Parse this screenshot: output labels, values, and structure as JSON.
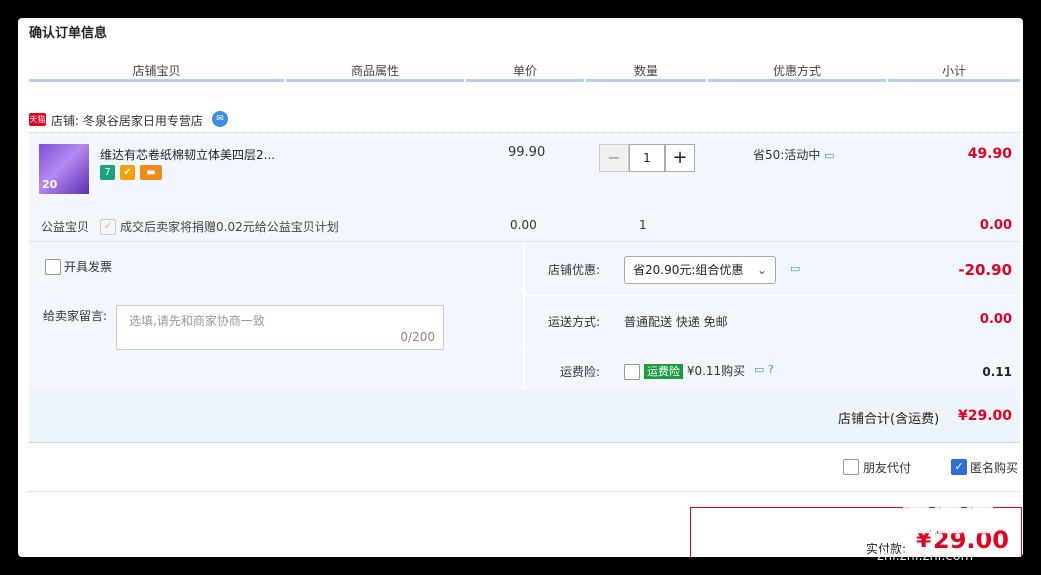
{
  "page": {
    "title": "确认订单信息"
  },
  "columns": [
    "店铺宝贝",
    "商品属性",
    "单价",
    "数量",
    "优惠方式",
    "小计"
  ],
  "shop": {
    "tmall_badge": "天猫",
    "label": "店铺: 冬泉谷居家日用专营店"
  },
  "item": {
    "thumb_text": "20",
    "title": "维达有芯卷纸棉韧立体美四层2...",
    "badges": [
      "7",
      "✔",
      "▬"
    ],
    "price": "99.90",
    "quantity": "1",
    "minus": "−",
    "plus": "+",
    "promo": "省50:活动中",
    "subtotal": "49.90"
  },
  "charity": {
    "label": "公益宝贝",
    "text": "成交后卖家将捐赠0.02元给公益宝贝计划",
    "price": "0.00",
    "quantity": "1",
    "subtotal": "0.00"
  },
  "invoice": {
    "label": "开具发票"
  },
  "message": {
    "label": "给卖家留言:",
    "placeholder": "选填,请先和商家协商一致",
    "counter": "0/200"
  },
  "discount": {
    "label": "店铺优惠:",
    "selected": "省20.90元:组合优惠",
    "amount": "-20.90"
  },
  "shipping": {
    "label": "运送方式:",
    "value": "普通配送 快递 免邮",
    "amount": "0.00"
  },
  "insurance": {
    "label": "运费险:",
    "badge": "运费险",
    "text": "¥0.11购买",
    "amount": "0.11"
  },
  "total": {
    "label": "店铺合计(含运费)",
    "amount": "¥29.00"
  },
  "options": {
    "friend_pay": "朋友代付",
    "anonymous": "匿名购买"
  },
  "pay": {
    "label": "实付款:",
    "currency": "¥",
    "amount": "29.00"
  },
  "watermark": {
    "logo": "值值值",
    "url": "zhi.zhi.zhi.com"
  }
}
